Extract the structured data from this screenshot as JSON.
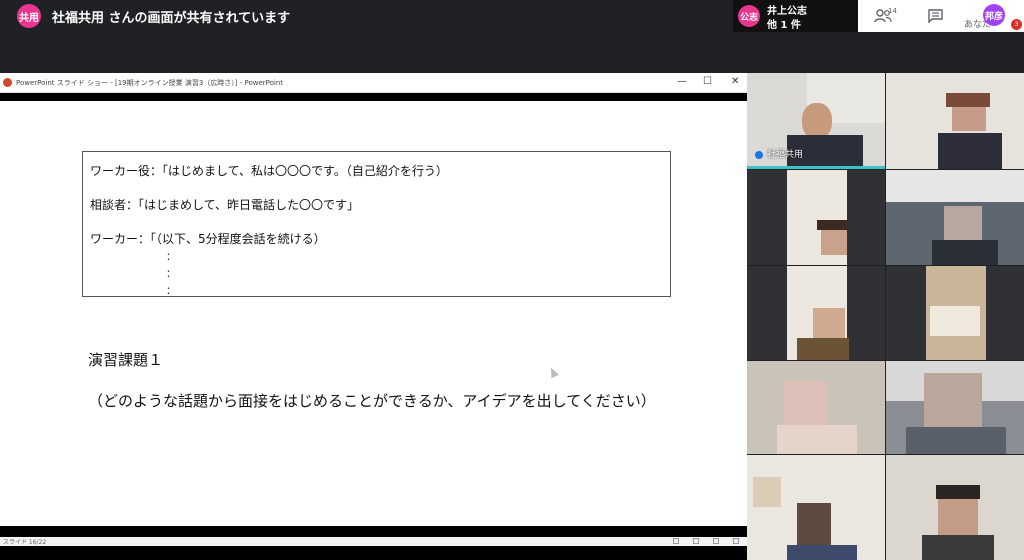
{
  "share_banner": {
    "avatar_text": "共用",
    "message": "社福共用 さんの画面が共有されています"
  },
  "presenters": {
    "avatar_text": "公志",
    "name": "井上公志",
    "others": "他 1 件"
  },
  "controls": {
    "people_count": "14",
    "me_label": "あなた",
    "me_avatar_text": "邦彦",
    "me_badge": "3"
  },
  "shared_window": {
    "title": "PowerPoint スライド ショー - [19期オンライン授業 演習3（広時さ）] - PowerPoint",
    "min_glyph": "—",
    "max_glyph": "☐",
    "close_glyph": "✕",
    "slide_counter": "スライド 16/22",
    "slide": {
      "line1": "ワーカー役：「はじめまして、私は〇〇〇です。（自己紹介を行う）",
      "line2": "相談者：「はじまめして、昨日電話した〇〇です」",
      "line3": "ワーカー：「（以下、5分程度会話を続ける）",
      "dot": "：",
      "exercise_title": "演習課題１",
      "exercise_question": "（どのような話題から面接をはじめることができるか、アイデアを出してください）"
    }
  },
  "participants": [
    {
      "name": "社福共用"
    },
    {
      "name": ""
    },
    {
      "name": ""
    },
    {
      "name": ""
    },
    {
      "name": ""
    },
    {
      "name": ""
    },
    {
      "name": ""
    },
    {
      "name": ""
    },
    {
      "name": ""
    },
    {
      "name": ""
    }
  ],
  "colors": {
    "meet_pink": "#e8368f",
    "meet_purple": "#a142f4",
    "background": "#202124"
  }
}
